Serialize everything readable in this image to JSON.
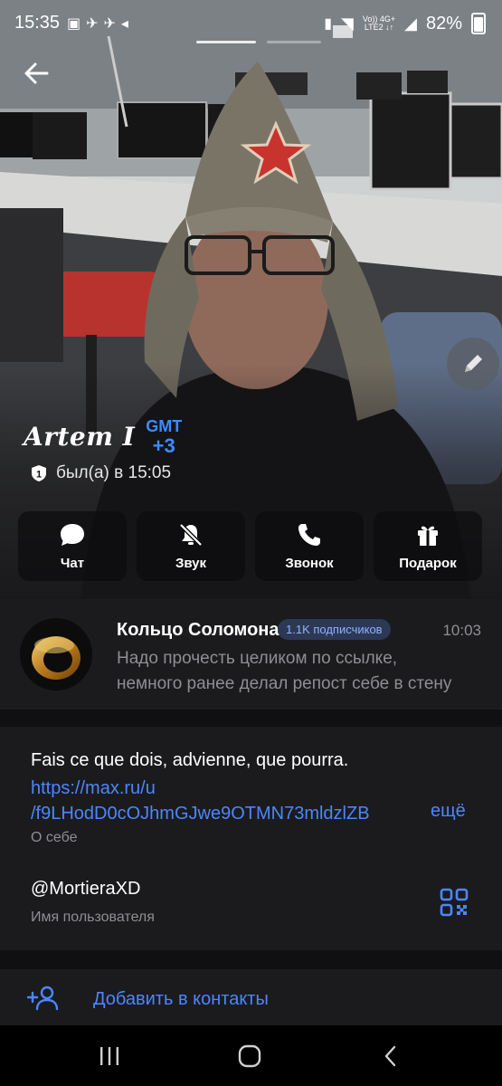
{
  "status_bar": {
    "time": "15:35",
    "network_top": "Vo)) 4G+",
    "network_bottom": "LTE2 ↓↑",
    "battery": "82%"
  },
  "profile": {
    "name": "Artem I",
    "timezone_label": "GMT",
    "timezone_offset": "+3",
    "last_seen": "был(а) в 15:05",
    "badge_number": "1"
  },
  "actions": [
    {
      "label": "Чат",
      "icon": "chat-bubble-icon"
    },
    {
      "label": "Звук",
      "icon": "bell-muted-icon"
    },
    {
      "label": "Звонок",
      "icon": "phone-icon"
    },
    {
      "label": "Подарок",
      "icon": "gift-icon"
    }
  ],
  "channel": {
    "title": "Кольцо Соломона",
    "subscribers": "1.1K подписчиков",
    "time": "10:03",
    "preview_line1": "Надо прочесть целиком по ссылке,",
    "preview_line2": "немного ранее делал репост себе в стену"
  },
  "info": {
    "bio_text": "Fais ce que dois, advienne, que pourra.",
    "bio_link_line1": "https://max.ru/u",
    "bio_link_line2": "/f9LHodD0cOJhmGJwe9OTMN73mldzlZB",
    "more_label": "ещё",
    "bio_caption": "О себе",
    "username": "@MortieraXD",
    "username_caption": "Имя пользователя"
  },
  "add_contact": {
    "label": "Добавить в контакты"
  },
  "colors": {
    "accent": "#4c86ff",
    "card_bg": "#1b1b1d",
    "page_bg": "#101012",
    "muted_text": "#8e8e93"
  }
}
